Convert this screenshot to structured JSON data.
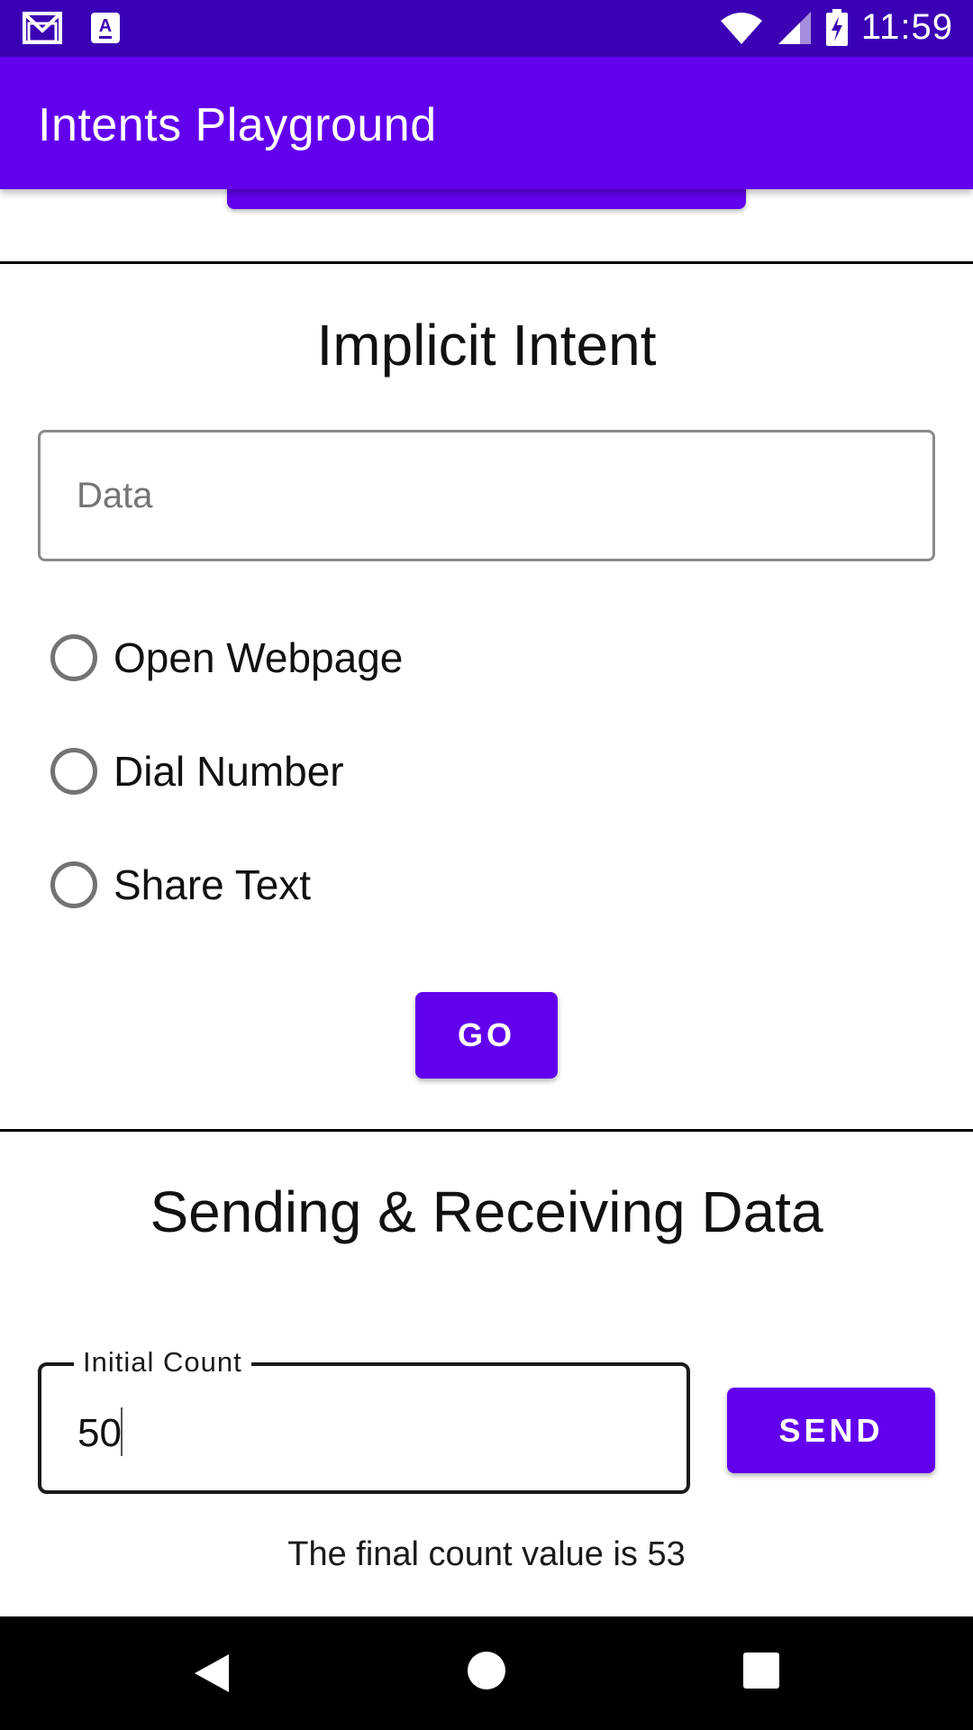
{
  "status_bar": {
    "time": "11:59",
    "icons": [
      "gmail-icon",
      "app-notification-icon",
      "wifi-icon",
      "signal-icon",
      "battery-charging-icon"
    ]
  },
  "app_bar": {
    "title": "Intents Playground"
  },
  "implicit": {
    "heading": "Implicit Intent",
    "data_placeholder": "Data",
    "data_value": "",
    "options": [
      {
        "label": "Open Webpage",
        "selected": false
      },
      {
        "label": "Dial Number",
        "selected": false
      },
      {
        "label": "Share Text",
        "selected": false
      }
    ],
    "go_label": "GO"
  },
  "sending": {
    "heading": "Sending & Receiving Data",
    "initial_count_label": "Initial Count",
    "initial_count_value": "50",
    "send_label": "SEND",
    "final_text": "The final count value is 53"
  },
  "colors": {
    "status_bar": "#3b00b3",
    "primary": "#6200ee",
    "nav_bar": "#000000"
  }
}
